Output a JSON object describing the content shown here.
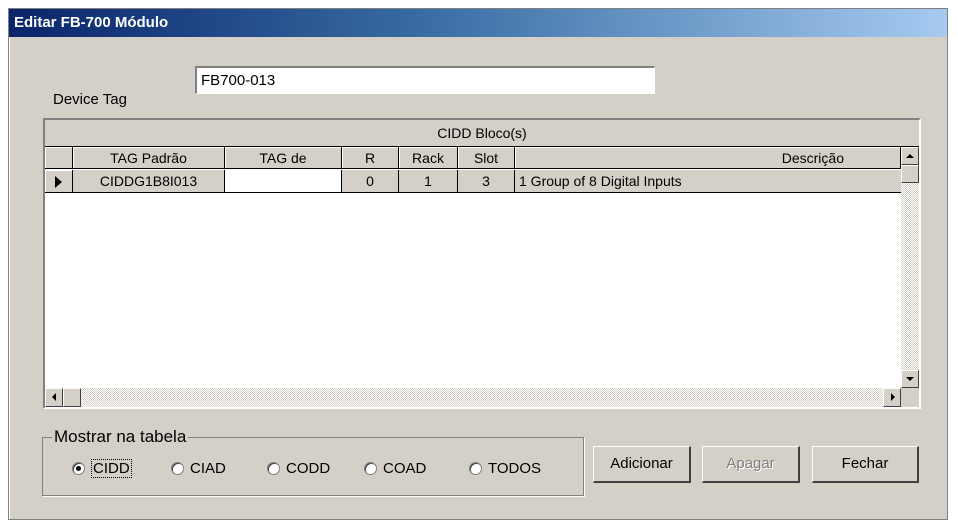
{
  "window": {
    "title": "Editar FB-700 Módulo"
  },
  "device_tag": {
    "label": "Device Tag",
    "value": "FB700-013"
  },
  "grid": {
    "caption": "CIDD Bloco(s)",
    "columns": [
      "TAG Padrão",
      "TAG de",
      "R",
      "Rack",
      "Slot",
      "Descrição"
    ],
    "rows": [
      {
        "tag_padrao": "CIDDG1B8I013",
        "tag_de": "",
        "r": "0",
        "rack": "1",
        "slot": "3",
        "descricao": "1 Group of 8 Digital Inputs"
      }
    ]
  },
  "filter": {
    "label": "Mostrar na tabela",
    "options": [
      "CIDD",
      "CIAD",
      "CODD",
      "COAD",
      "TODOS"
    ],
    "selected": "CIDD"
  },
  "buttons": {
    "add": "Adicionar",
    "delete": "Apagar",
    "close": "Fechar"
  },
  "colors": {
    "dialog_bg": "#d4d0c8",
    "title_start": "#0a246a",
    "title_end": "#a6caf0"
  },
  "icons": [
    "row-pointer-icon",
    "scroll-up-icon",
    "scroll-down-icon",
    "scroll-left-icon",
    "scroll-right-icon",
    "radio-selected-icon",
    "radio-unselected-icon"
  ]
}
